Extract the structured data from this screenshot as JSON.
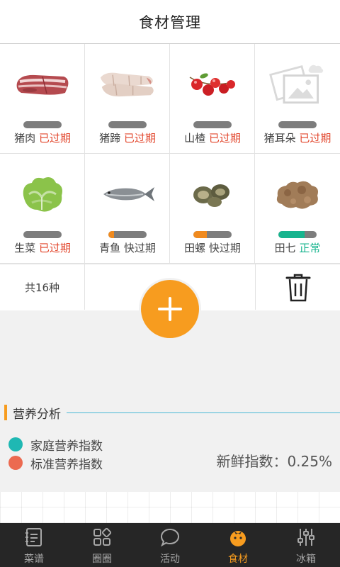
{
  "header": {
    "title": "食材管理"
  },
  "items": [
    {
      "name": "猪肉",
      "status": "已过期",
      "status_type": "expired",
      "freshness": 0,
      "icon": "pork-image"
    },
    {
      "name": "猪蹄",
      "status": "已过期",
      "status_type": "expired",
      "freshness": 0,
      "icon": "trotters-image"
    },
    {
      "name": "山楂",
      "status": "已过期",
      "status_type": "expired",
      "freshness": 0,
      "icon": "hawthorn-image"
    },
    {
      "name": "猪耳朵",
      "status": "已过期",
      "status_type": "expired",
      "freshness": 0,
      "icon": "image-placeholder"
    },
    {
      "name": "生菜",
      "status": "已过期",
      "status_type": "expired",
      "freshness": 0,
      "icon": "lettuce-image"
    },
    {
      "name": "青鱼",
      "status": "快过期",
      "status_type": "soon",
      "freshness": 0.15,
      "icon": "fish-image"
    },
    {
      "name": "田螺",
      "status": "快过期",
      "status_type": "soon",
      "freshness": 0.35,
      "icon": "snail-image"
    },
    {
      "name": "田七",
      "status": "正常",
      "status_type": "ok",
      "freshness": 0.68,
      "icon": "ginseng-root-image"
    }
  ],
  "colors": {
    "expired": "#e2452b",
    "soon_fill": "#f08a1e",
    "ok_fill": "#17b48e",
    "accent": "#f79c1f",
    "family_dot": "#1fb8b3",
    "standard_dot": "#ec6a50"
  },
  "actions": {
    "count": "共16种",
    "add_icon": "plus-icon",
    "delete_icon": "trash-icon"
  },
  "analysis": {
    "title": "营养分析",
    "legend": [
      {
        "label": "家庭营养指数"
      },
      {
        "label": "标准营养指数"
      }
    ],
    "fresh_label": "新鲜指数：0.25%"
  },
  "tabs": [
    {
      "label": "菜谱",
      "icon": "recipe-book-icon",
      "active": false
    },
    {
      "label": "圈圈",
      "icon": "circles-icon",
      "active": false
    },
    {
      "label": "活动",
      "icon": "chat-bubble-icon",
      "active": false
    },
    {
      "label": "食材",
      "icon": "tomato-icon",
      "active": true
    },
    {
      "label": "冰箱",
      "icon": "sliders-icon",
      "active": false
    }
  ]
}
